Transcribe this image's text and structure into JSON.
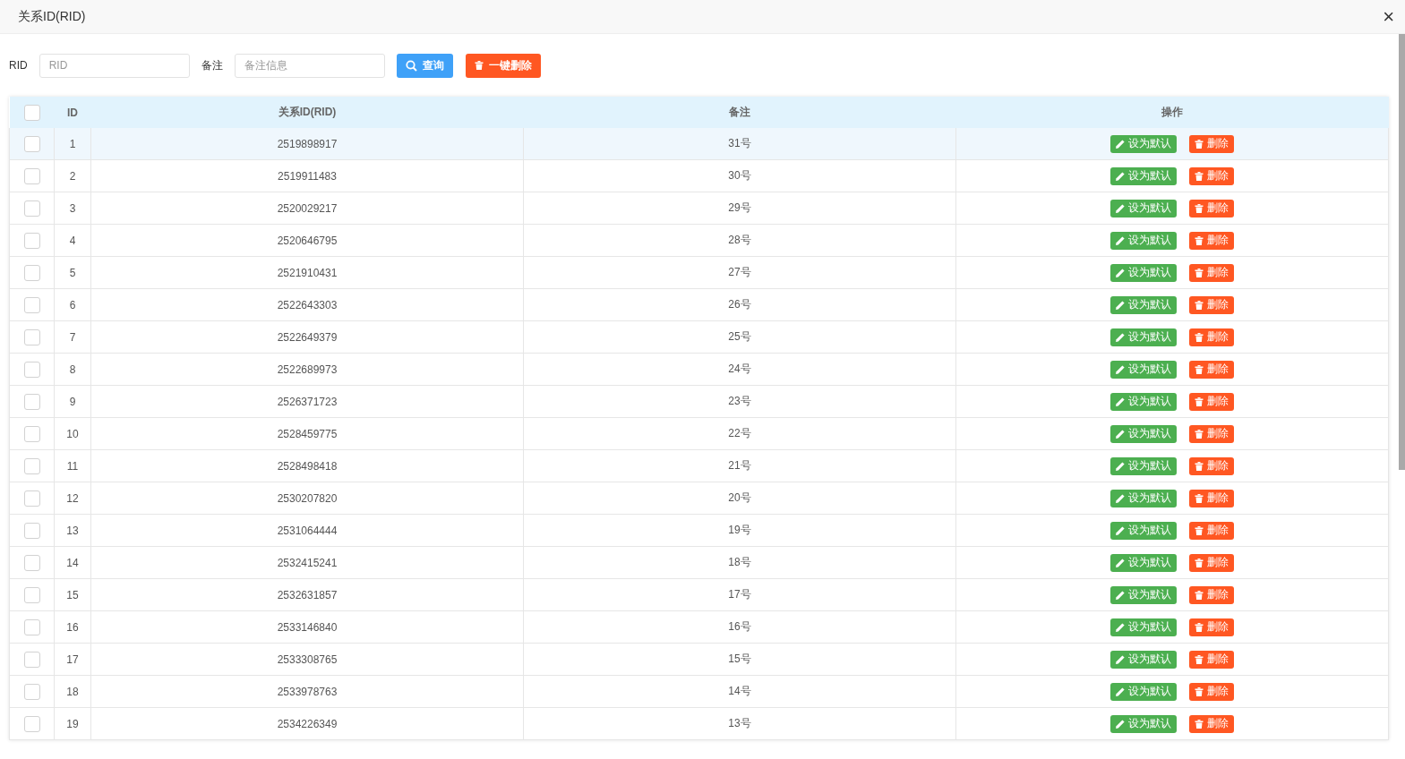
{
  "window": {
    "title": "关系ID(RID)",
    "close": "×"
  },
  "filters": [
    {
      "label": "RID",
      "placeholder": "RID"
    },
    {
      "label": "备注",
      "placeholder": "备注信息"
    }
  ],
  "actions": [
    {
      "kind": "search",
      "label": "查询"
    },
    {
      "kind": "danger",
      "label": "一键删除"
    }
  ],
  "table": {
    "columns": [
      "ID",
      "关系ID(RID)",
      "备注",
      "操作"
    ],
    "all_checked": false,
    "rows": [
      {
        "id": "1",
        "rid": "2519898917",
        "remark": "31号",
        "checked": false,
        "highlighted": true,
        "actions": [
          {
            "kind": "primary",
            "label": "设为默认"
          },
          {
            "kind": "danger",
            "label": "删除"
          }
        ]
      },
      {
        "id": "2",
        "rid": "2519911483",
        "remark": "30号",
        "checked": false,
        "highlighted": false,
        "actions": [
          {
            "kind": "primary",
            "label": "设为默认"
          },
          {
            "kind": "danger",
            "label": "删除"
          }
        ]
      },
      {
        "id": "3",
        "rid": "2520029217",
        "remark": "29号",
        "checked": false,
        "highlighted": false,
        "actions": [
          {
            "kind": "primary",
            "label": "设为默认"
          },
          {
            "kind": "danger",
            "label": "删除"
          }
        ]
      },
      {
        "id": "4",
        "rid": "2520646795",
        "remark": "28号",
        "checked": false,
        "highlighted": false,
        "actions": [
          {
            "kind": "primary",
            "label": "设为默认"
          },
          {
            "kind": "danger",
            "label": "删除"
          }
        ]
      },
      {
        "id": "5",
        "rid": "2521910431",
        "remark": "27号",
        "checked": false,
        "highlighted": false,
        "actions": [
          {
            "kind": "primary",
            "label": "设为默认"
          },
          {
            "kind": "danger",
            "label": "删除"
          }
        ]
      },
      {
        "id": "6",
        "rid": "2522643303",
        "remark": "26号",
        "checked": false,
        "highlighted": false,
        "actions": [
          {
            "kind": "primary",
            "label": "设为默认"
          },
          {
            "kind": "danger",
            "label": "删除"
          }
        ]
      },
      {
        "id": "7",
        "rid": "2522649379",
        "remark": "25号",
        "checked": false,
        "highlighted": false,
        "actions": [
          {
            "kind": "primary",
            "label": "设为默认"
          },
          {
            "kind": "danger",
            "label": "删除"
          }
        ]
      },
      {
        "id": "8",
        "rid": "2522689973",
        "remark": "24号",
        "checked": false,
        "highlighted": false,
        "actions": [
          {
            "kind": "primary",
            "label": "设为默认"
          },
          {
            "kind": "danger",
            "label": "删除"
          }
        ]
      },
      {
        "id": "9",
        "rid": "2526371723",
        "remark": "23号",
        "checked": false,
        "highlighted": false,
        "actions": [
          {
            "kind": "primary",
            "label": "设为默认"
          },
          {
            "kind": "danger",
            "label": "删除"
          }
        ]
      },
      {
        "id": "10",
        "rid": "2528459775",
        "remark": "22号",
        "checked": false,
        "highlighted": false,
        "actions": [
          {
            "kind": "primary",
            "label": "设为默认"
          },
          {
            "kind": "danger",
            "label": "删除"
          }
        ]
      },
      {
        "id": "11",
        "rid": "2528498418",
        "remark": "21号",
        "checked": false,
        "highlighted": false,
        "actions": [
          {
            "kind": "primary",
            "label": "设为默认"
          },
          {
            "kind": "danger",
            "label": "删除"
          }
        ]
      },
      {
        "id": "12",
        "rid": "2530207820",
        "remark": "20号",
        "checked": false,
        "highlighted": false,
        "actions": [
          {
            "kind": "primary",
            "label": "设为默认"
          },
          {
            "kind": "danger",
            "label": "删除"
          }
        ]
      },
      {
        "id": "13",
        "rid": "2531064444",
        "remark": "19号",
        "checked": false,
        "highlighted": false,
        "actions": [
          {
            "kind": "primary",
            "label": "设为默认"
          },
          {
            "kind": "danger",
            "label": "删除"
          }
        ]
      },
      {
        "id": "14",
        "rid": "2532415241",
        "remark": "18号",
        "checked": false,
        "highlighted": false,
        "actions": [
          {
            "kind": "primary",
            "label": "设为默认"
          },
          {
            "kind": "danger",
            "label": "删除"
          }
        ]
      },
      {
        "id": "15",
        "rid": "2532631857",
        "remark": "17号",
        "checked": false,
        "highlighted": false,
        "actions": [
          {
            "kind": "primary",
            "label": "设为默认"
          },
          {
            "kind": "danger",
            "label": "删除"
          }
        ]
      },
      {
        "id": "16",
        "rid": "2533146840",
        "remark": "16号",
        "checked": false,
        "highlighted": false,
        "actions": [
          {
            "kind": "primary",
            "label": "设为默认"
          },
          {
            "kind": "danger",
            "label": "删除"
          }
        ]
      },
      {
        "id": "17",
        "rid": "2533308765",
        "remark": "15号",
        "checked": false,
        "highlighted": false,
        "actions": [
          {
            "kind": "primary",
            "label": "设为默认"
          },
          {
            "kind": "danger",
            "label": "删除"
          }
        ]
      },
      {
        "id": "18",
        "rid": "2533978763",
        "remark": "14号",
        "checked": false,
        "highlighted": false,
        "actions": [
          {
            "kind": "primary",
            "label": "设为默认"
          },
          {
            "kind": "danger",
            "label": "删除"
          }
        ]
      },
      {
        "id": "19",
        "rid": "2534226349",
        "remark": "13号",
        "checked": false,
        "highlighted": false,
        "actions": [
          {
            "kind": "primary",
            "label": "设为默认"
          },
          {
            "kind": "danger",
            "label": "删除"
          }
        ]
      }
    ]
  }
}
